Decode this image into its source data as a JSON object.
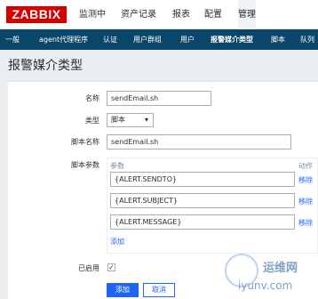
{
  "brand": {
    "logo_text": "ZABBIX"
  },
  "topnav": {
    "items": [
      {
        "label": "监测中"
      },
      {
        "label": "资产记录"
      },
      {
        "label": "报表"
      },
      {
        "label": "配置"
      },
      {
        "label": "管理",
        "active": true
      }
    ]
  },
  "subnav": {
    "items": [
      {
        "label": "一般"
      },
      {
        "label": "agent代理程序"
      },
      {
        "label": "认证"
      },
      {
        "label": "用户群组"
      },
      {
        "label": "用户"
      },
      {
        "label": "报警媒介类型",
        "active": true
      },
      {
        "label": "脚本"
      },
      {
        "label": "队列"
      }
    ]
  },
  "page": {
    "title": "报警媒介类型"
  },
  "form": {
    "name_label": "名称",
    "name_value": "sendEmail.sh",
    "type_label": "类型",
    "type_value": "脚本",
    "script_name_label": "脚本名称",
    "script_name_value": "sendEmail.sh",
    "script_params_label": "脚本参数",
    "params_col_header": "参数",
    "action_col_header": "动作",
    "params": [
      {
        "value": "{ALERT.SENDTO}",
        "remove_label": "移除"
      },
      {
        "value": "{ALERT.SUBJECT}",
        "remove_label": "移除"
      },
      {
        "value": "{ALERT.MESSAGE}",
        "remove_label": "移除"
      }
    ],
    "add_param_label": "添加",
    "enabled_label": "已启用",
    "enabled_checked": true,
    "add_button": "添加",
    "cancel_button": "取消"
  },
  "watermark": {
    "title": "运维网",
    "url": "iyunv.com"
  },
  "colors": {
    "accent": "#1f65f4",
    "subnav_bg": "#0a466a",
    "logo_bg": "#d40000"
  }
}
